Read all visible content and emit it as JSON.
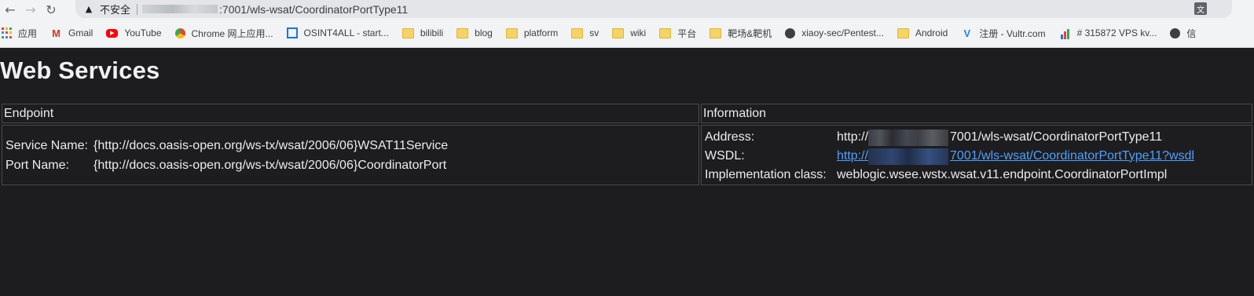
{
  "browser": {
    "security_label": "不安全",
    "url_suffix": ":7001/wls-wsat/CoordinatorPortType11",
    "bookmarks": [
      {
        "label": "应用",
        "icon": "apps-grid-icon"
      },
      {
        "label": "Gmail",
        "icon": "gmail-icon"
      },
      {
        "label": "YouTube",
        "icon": "youtube-icon"
      },
      {
        "label": "Chrome 网上应用...",
        "icon": "chrome-webstore-icon"
      },
      {
        "label": "OSINT4ALL - start...",
        "icon": "osint-icon"
      },
      {
        "label": "bilibili",
        "icon": "folder-icon"
      },
      {
        "label": "blog",
        "icon": "folder-icon"
      },
      {
        "label": "platform",
        "icon": "folder-icon"
      },
      {
        "label": "sv",
        "icon": "folder-icon"
      },
      {
        "label": "wiki",
        "icon": "folder-icon"
      },
      {
        "label": "平台",
        "icon": "folder-icon"
      },
      {
        "label": "靶场&靶机",
        "icon": "folder-icon"
      },
      {
        "label": "xiaoy-sec/Pentest...",
        "icon": "github-icon"
      },
      {
        "label": "Android",
        "icon": "folder-icon"
      },
      {
        "label": "注册 - Vultr.com",
        "icon": "vultr-icon"
      },
      {
        "label": "# 315872 VPS kv...",
        "icon": "chart-bars-icon"
      },
      {
        "label": "信",
        "icon": "github-icon"
      }
    ]
  },
  "page": {
    "title": "Web Services",
    "headers": {
      "endpoint": "Endpoint",
      "information": "Information"
    },
    "endpoint": {
      "service_name_label": "Service Name:",
      "service_name_value": "{http://docs.oasis-open.org/ws-tx/wsat/2006/06}WSAT11Service",
      "port_name_label": "Port Name:",
      "port_name_value": "{http://docs.oasis-open.org/ws-tx/wsat/2006/06}CoordinatorPort"
    },
    "information": {
      "address_label": "Address:",
      "address_prefix": "http://",
      "address_suffix": "7001/wls-wsat/CoordinatorPortType11",
      "wsdl_label": "WSDL:",
      "wsdl_prefix": "http://",
      "wsdl_suffix": "7001/wls-wsat/CoordinatorPortType11?wsdl",
      "impl_label": "Implementation class:",
      "impl_value": "weblogic.wsee.wstx.wsat.v11.endpoint.CoordinatorPortImpl"
    }
  }
}
